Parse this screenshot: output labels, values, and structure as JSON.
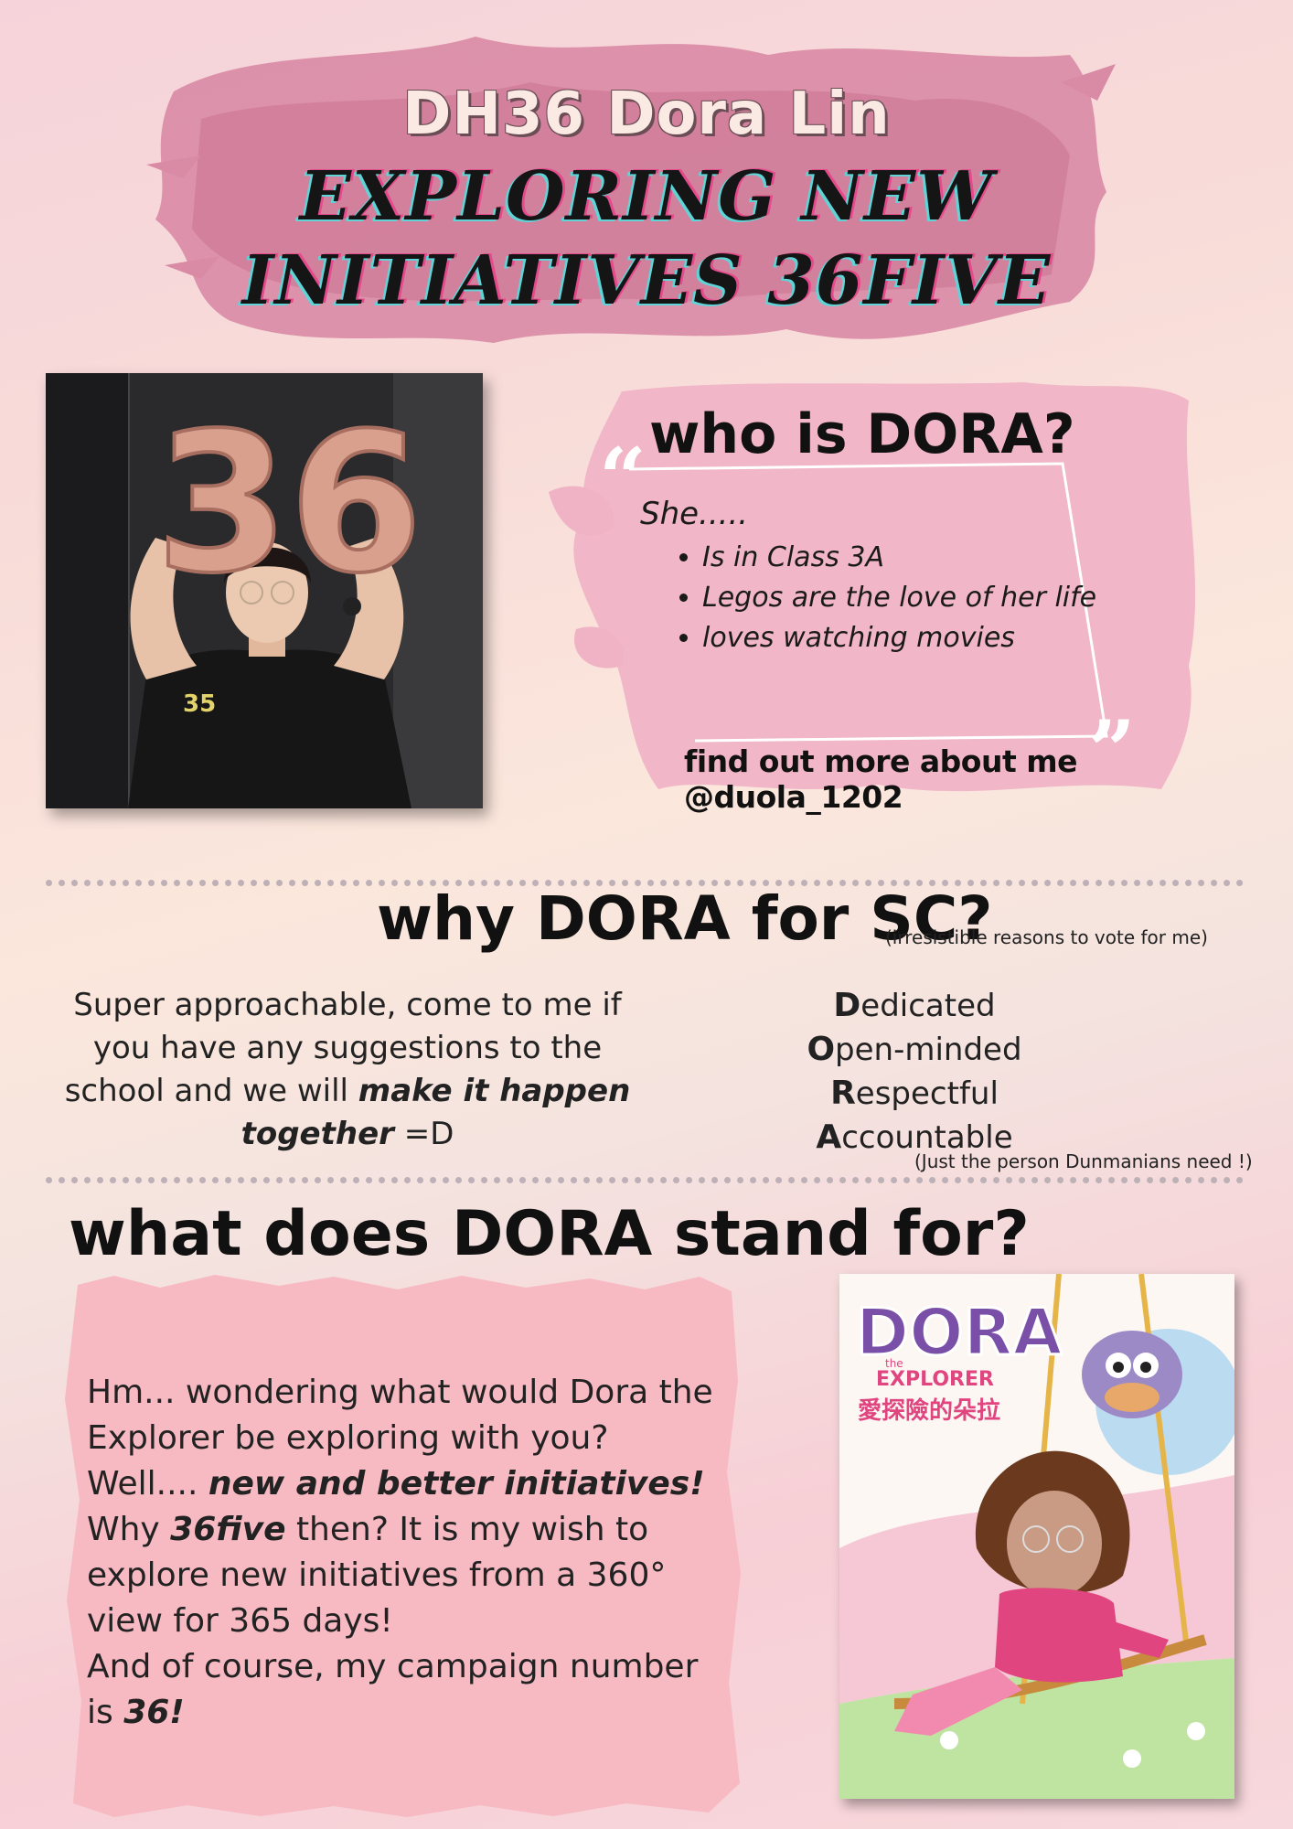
{
  "header": {
    "name": "DH36 Dora Lin",
    "headline_line1": "EXPLORING NEW",
    "headline_line2": "INITIATIVES 36FIVE"
  },
  "profile": {
    "photo_balloon_text": "36",
    "title": "who is DORA?",
    "intro": "She.....",
    "facts": [
      "Is in Class 3A",
      "Legos are the love of her life",
      "loves watching movies"
    ],
    "social": "find out more about me @duola_1202"
  },
  "why": {
    "title": "why DORA for SC?",
    "note": "(irresistible reasons to vote for me)",
    "body_start": "Super approachable, come to me if you have any suggestions to the school and we will ",
    "body_em": "make it happen together",
    "body_end": " =D",
    "traits": [
      {
        "first": "D",
        "rest": "edicated"
      },
      {
        "first": "O",
        "rest": "pen-minded"
      },
      {
        "first": "R",
        "rest": "espectful"
      },
      {
        "first": "A",
        "rest": "ccountable"
      }
    ],
    "traits_note": "(Just the person Dunmanians need !)"
  },
  "stand": {
    "title": "what does DORA stand for?",
    "p1": "Hm... wondering what would Dora the Explorer be exploring with you?",
    "p2_start": "Well.... ",
    "p2_em": "new and better initiatives!",
    "p3_start": "Why ",
    "p3_em": "36five",
    "p3_end": " then? It  is my wish to explore new initiatives from a 360° view for 365 days!",
    "p4_start": "And of course, my campaign number is ",
    "p4_em": "36!"
  },
  "poster": {
    "logo": "DORA",
    "logo_small": "the",
    "subtitle": "EXPLORER",
    "chinese": "愛探險的朵拉"
  },
  "colors": {
    "brush_pink": "#d98aa5",
    "panel_pink": "#f0b3c6",
    "paper_pink": "#f7b9c2",
    "ink": "#111111"
  }
}
